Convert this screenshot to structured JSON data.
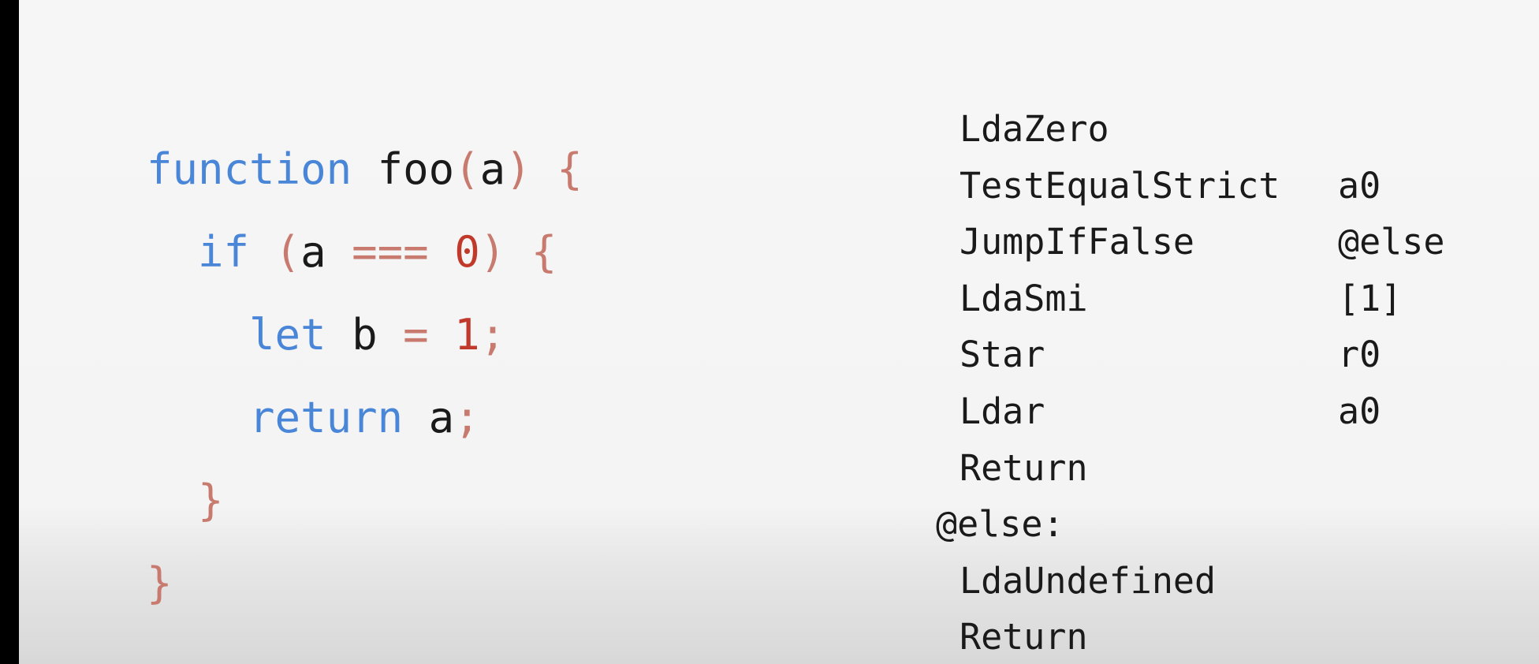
{
  "js_source": {
    "line1": {
      "kw": "function",
      "name": "foo",
      "lparen": "(",
      "param": "a",
      "rparen": ")",
      "brace": "{"
    },
    "line2": {
      "kw": "if",
      "lparen": "(",
      "var": "a",
      "op": "===",
      "num": "0",
      "rparen": ")",
      "brace": "{"
    },
    "line3": {
      "kw": "let",
      "var": "b",
      "op": "=",
      "num": "1",
      "semi": ";"
    },
    "line4": {
      "kw": "return",
      "var": "a",
      "semi": ";"
    },
    "line5": {
      "brace": "}"
    },
    "line6": {
      "brace": "}"
    }
  },
  "bytecode": {
    "rows": [
      {
        "op": "LdaZero",
        "arg": ""
      },
      {
        "op": "TestEqualStrict",
        "arg": "a0"
      },
      {
        "op": "JumpIfFalse",
        "arg": "@else"
      },
      {
        "op": "LdaSmi",
        "arg": "[1]"
      },
      {
        "op": "Star",
        "arg": "r0"
      },
      {
        "op": "Ldar",
        "arg": "a0"
      },
      {
        "op": "Return",
        "arg": ""
      }
    ],
    "label": "@else:",
    "rows_after": [
      {
        "op": "LdaUndefined",
        "arg": ""
      },
      {
        "op": "Return",
        "arg": ""
      }
    ]
  },
  "colors": {
    "keyword": "#4a86d8",
    "punctuation": "#c87a6e",
    "number": "#c0392b",
    "text": "#1a1a1a"
  }
}
